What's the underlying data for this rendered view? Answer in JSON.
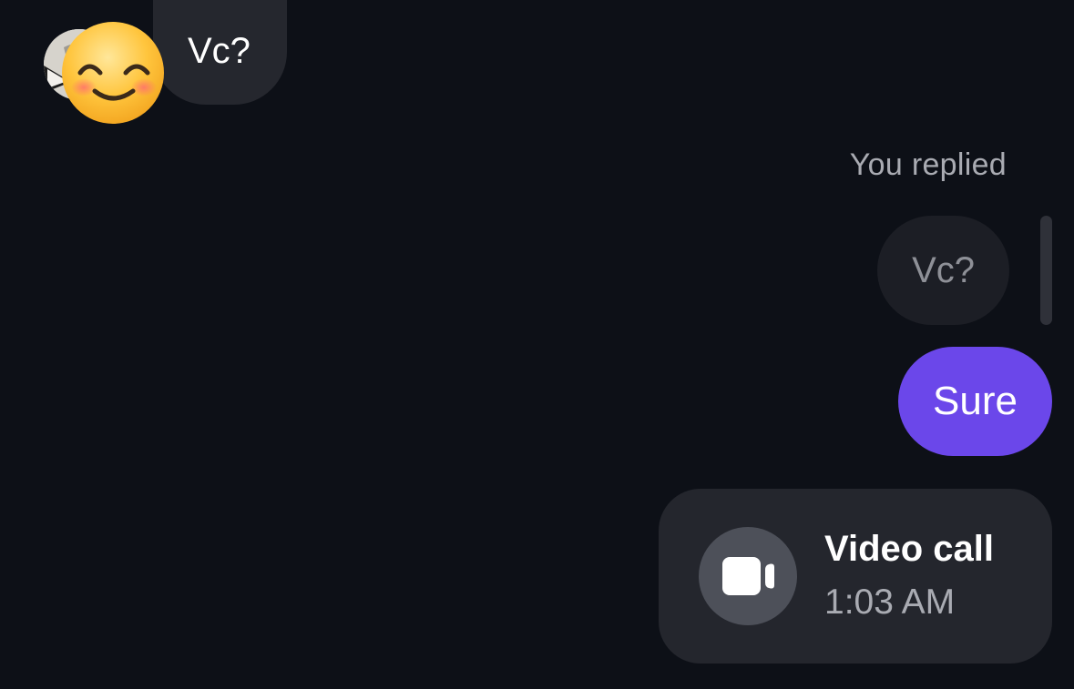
{
  "incoming_message": {
    "text": "Vc?",
    "reaction_emoji": "smiling-face-icon"
  },
  "reply": {
    "label": "You replied",
    "quoted_text": "Vc?",
    "text": "Sure"
  },
  "video_call": {
    "title": "Video call",
    "time": "1:03 AM",
    "icon": "video-camera-icon"
  },
  "colors": {
    "background": "#0d1017",
    "incoming_bubble": "#25272e",
    "quoted_bubble": "#1c1e25",
    "outgoing_bubble": "#6b47ea",
    "call_card": "#24262d"
  }
}
